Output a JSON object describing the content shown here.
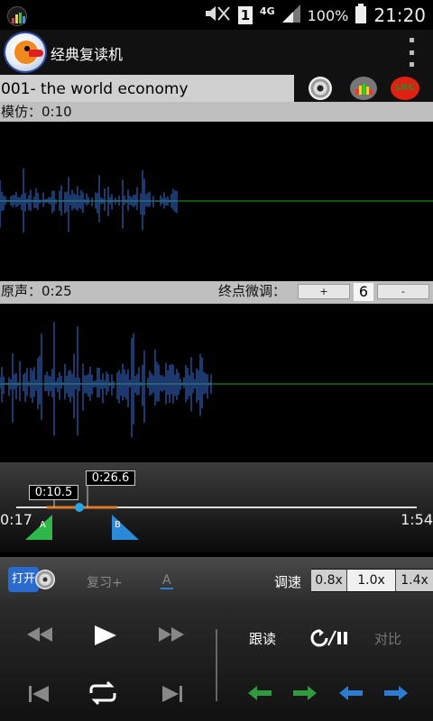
{
  "status_bar": {
    "sim_label": "1",
    "network": "4G",
    "battery": "100%",
    "time": "21:20"
  },
  "app": {
    "title": "经典复读机",
    "icons": [
      "equalizer-icon",
      "menu-icon",
      "parrot-logo-icon"
    ]
  },
  "track": {
    "name": "001- the world economy",
    "buttons": [
      "disc-icon",
      "equalizer-icon",
      "lrc-icon"
    ],
    "lrc_label": "LRC"
  },
  "imitation": {
    "label": "模仿：0:10"
  },
  "original": {
    "label": "原声：0:25",
    "endpoint_label": "终点微调：",
    "plus_label": "+",
    "value": "6",
    "minus_label": "-"
  },
  "timeline": {
    "marker_a_time": "0:10.5",
    "marker_b_time": "0:26.6",
    "start_time": "0:17",
    "end_time": "1:54",
    "a_label": "A",
    "b_label": "B",
    "wave_colors": {
      "imitation": "#3a6fd8",
      "original": "#3a6fd8",
      "baseline": "#1fa81f"
    }
  },
  "controls_top": {
    "open_label": "打开",
    "repeat_plus_label": "复习+",
    "a_label": "A",
    "speed_label": "调速",
    "speeds": [
      "0.8x",
      "1.0x",
      "1.4x"
    ],
    "active_speed": "1.0x"
  },
  "controls_bottom": {
    "follow_label": "跟读",
    "compare_label": "对比",
    "play_icon": "play-icon"
  }
}
